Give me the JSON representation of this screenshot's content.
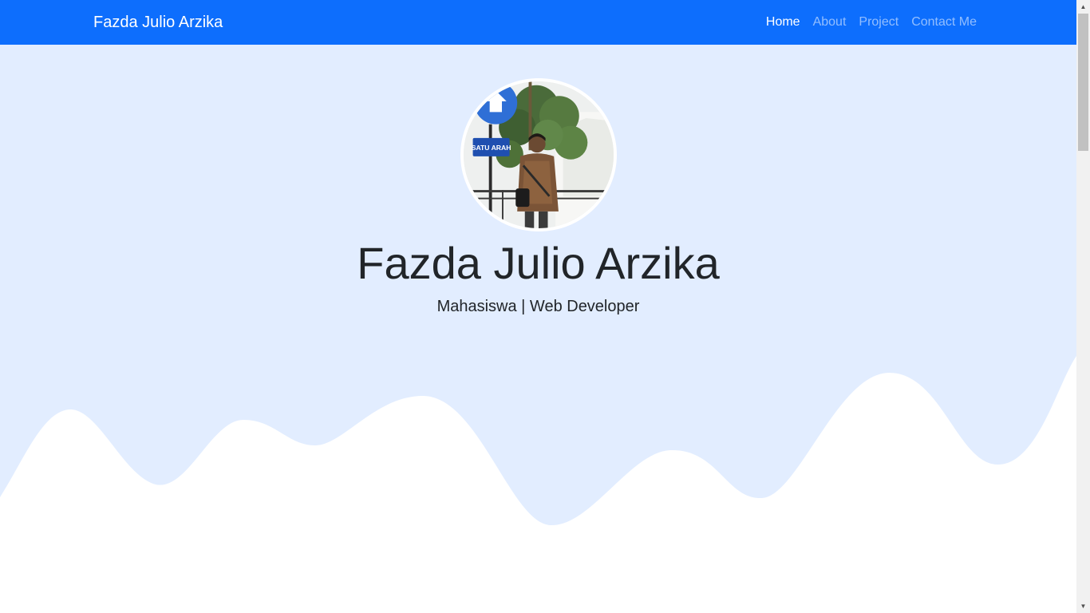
{
  "navbar": {
    "brand": "Fazda Julio Arzika",
    "links": [
      {
        "label": "Home",
        "active": true
      },
      {
        "label": "About",
        "active": false
      },
      {
        "label": "Project",
        "active": false
      },
      {
        "label": "Contact Me",
        "active": false
      }
    ]
  },
  "hero": {
    "name": "Fazda Julio Arzika",
    "tagline": "Mahasiswa | Web Developer",
    "photo_sign_text": "SATU ARAH"
  },
  "colors": {
    "navbar_bg": "#0d6efd",
    "hero_bg": "#e2edff",
    "wave_fill": "#ffffff"
  },
  "scrollbar": {
    "up_arrow_icon": "scroll-up-arrow-icon",
    "down_arrow_icon": "scroll-down-arrow-icon"
  }
}
